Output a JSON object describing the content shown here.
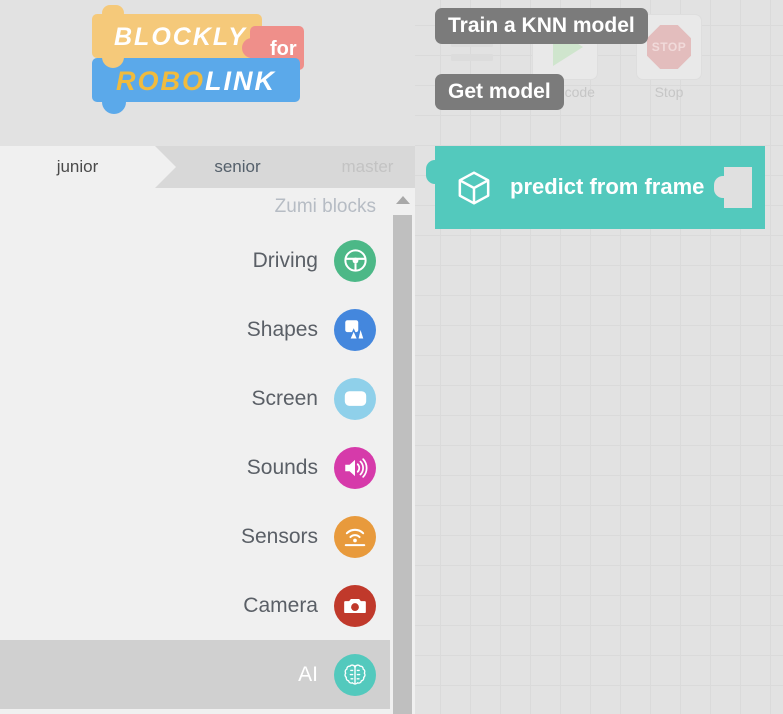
{
  "app": {
    "logo": {
      "word1": "BLOCKLY",
      "word2_prefix": "ROBO",
      "word2_suffix": "LINK",
      "connector": "for",
      "colors": {
        "top_block": "#f5c97a",
        "for_block": "#ef8f8a",
        "bottom_block": "#5ba9ea",
        "highlight": "#f0bb3e"
      }
    }
  },
  "tabs": [
    {
      "id": "junior",
      "label": "junior",
      "state": "active"
    },
    {
      "id": "senior",
      "label": "senior",
      "state": "inactive"
    },
    {
      "id": "master",
      "label": "master",
      "state": "disabled"
    }
  ],
  "sidebar": {
    "header": "Zumi blocks",
    "scrollbar": {
      "up_arrow": "caret-up-icon"
    },
    "items": [
      {
        "label": "Driving",
        "icon": "steering-wheel-icon",
        "color": "#4cb887",
        "selected": false
      },
      {
        "label": "Shapes",
        "icon": "shapes-icon",
        "color": "#4487dd",
        "selected": false
      },
      {
        "label": "Screen",
        "icon": "screen-icon",
        "color": "#8fd0ea",
        "selected": false
      },
      {
        "label": "Sounds",
        "icon": "speaker-icon",
        "color": "#d63aaa",
        "selected": false
      },
      {
        "label": "Sensors",
        "icon": "sensor-wifi-icon",
        "color": "#e89a3c",
        "selected": false
      },
      {
        "label": "Camera",
        "icon": "camera-icon",
        "color": "#c0392b",
        "selected": false
      },
      {
        "label": "AI",
        "icon": "brain-icon",
        "color": "#53c9bd",
        "selected": true
      }
    ]
  },
  "toolbar": {
    "buttons": [
      {
        "id": "menu",
        "icon": "list-menu-icon",
        "label": ""
      },
      {
        "id": "run",
        "icon": "play-icon",
        "label": "Run code",
        "state": "faded"
      },
      {
        "id": "stop",
        "icon": "stop-sign-icon",
        "label": "Stop",
        "badge": "STOP",
        "state": "faded"
      }
    ]
  },
  "tooltips": [
    {
      "id": "train",
      "text": "Train a KNN model"
    },
    {
      "id": "get",
      "text": "Get model"
    }
  ],
  "workspace": {
    "block": {
      "label": "predict from frame",
      "icon": "cube-icon",
      "color": "#53c9bd",
      "has_left_notch": true,
      "has_right_socket": true
    }
  }
}
